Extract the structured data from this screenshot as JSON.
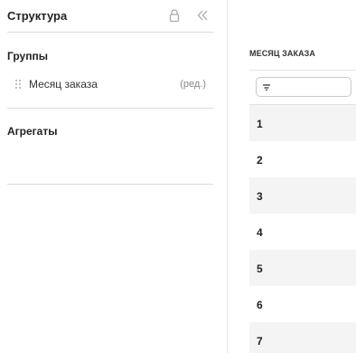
{
  "sidebar": {
    "title": "Структура",
    "groups_label": "Группы",
    "group_items": [
      {
        "label": "Месяц заказа",
        "edit": "(ред.)"
      }
    ],
    "aggregates_label": "Агрегаты"
  },
  "table": {
    "column_header": "МЕСЯЦ ЗАКАЗА",
    "rows": [
      "1",
      "2",
      "3",
      "4",
      "5",
      "6",
      "7"
    ]
  }
}
